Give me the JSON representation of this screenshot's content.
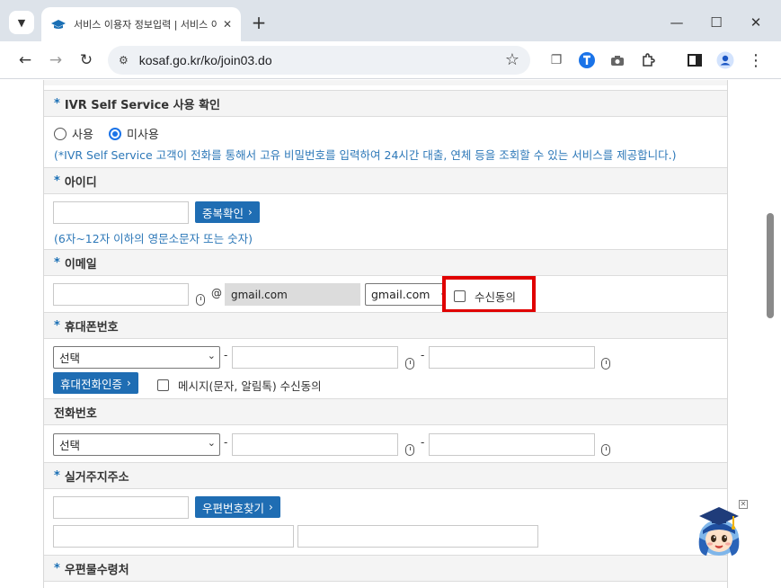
{
  "browser": {
    "tab_title": "서비스 이용자 정보입력 | 서비스 이용",
    "url": "kosaf.go.kr/ko/join03.do"
  },
  "form": {
    "ivr": {
      "label": "IVR Self Service 사용 확인",
      "options": [
        "사용",
        "미사용"
      ],
      "selected": "미사용",
      "note": "(*IVR Self Service 고객이 전화를 통해서 고유 비밀번호를 입력하여 24시간 대출, 연체 등을 조회할 수 있는 서비스를 제공합니다.)"
    },
    "userid": {
      "label": "아이디",
      "value": "",
      "check_button": "중복확인",
      "note": "(6자~12자 이하의 영문소문자 또는 숫자)"
    },
    "email": {
      "label": "이메일",
      "local_value": "",
      "at": "@",
      "domain_value": "gmail.com",
      "domain_select": "gmail.com",
      "consent_label": "수신동의"
    },
    "mobile": {
      "label": "휴대폰번호",
      "prefix_select": "선택",
      "dash": "-",
      "verify_button": "휴대전화인증",
      "consent_label": "메시지(문자, 알림톡) 수신동의"
    },
    "phone": {
      "label": "전화번호",
      "prefix_select": "선택",
      "dash": "-"
    },
    "address": {
      "label": "실거주지주소",
      "zip_button": "우편번호찾기"
    },
    "mail_recipient": {
      "label": "우편물수령처"
    },
    "required_mark": "*"
  },
  "colors": {
    "accent": "#1f6db3",
    "note_text": "#2d78b8",
    "highlight": "#e00000"
  }
}
